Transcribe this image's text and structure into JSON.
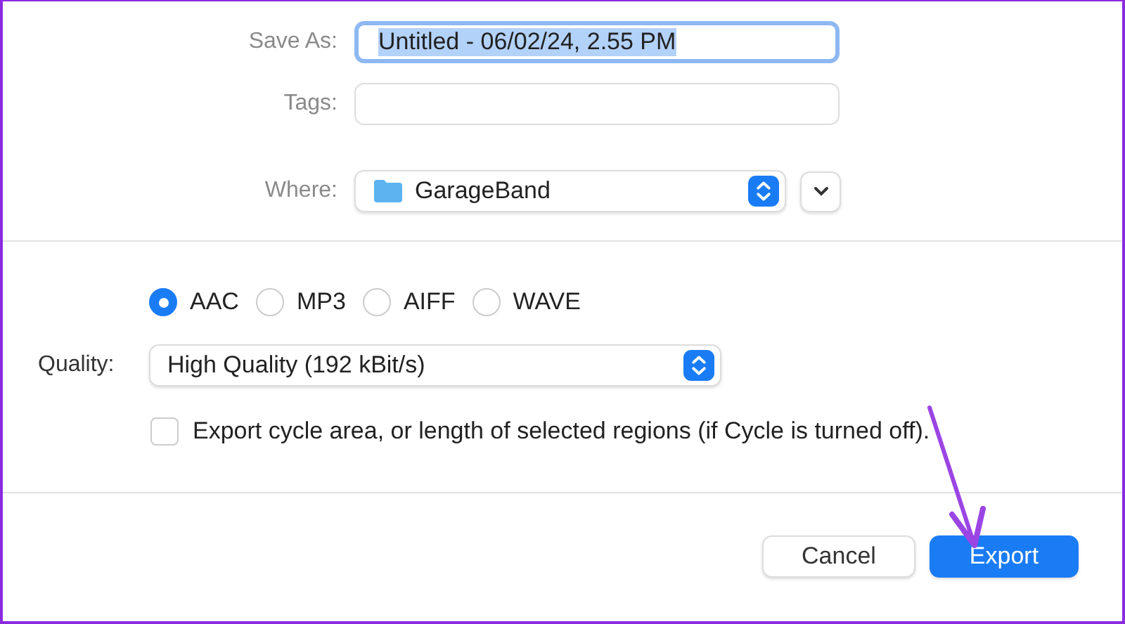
{
  "fields": [
    {
      "kind": "text",
      "label": "Save As:",
      "value": "Untitled - 06/02/24, 2.55 PM",
      "focused": true,
      "text_selected": true
    },
    {
      "kind": "text",
      "label": "Tags:",
      "focused": false
    },
    {
      "kind": "location",
      "label": "Where:",
      "value": "GarageBand",
      "expanded": false
    }
  ],
  "formats": [
    {
      "label": "AAC",
      "selected": true
    },
    {
      "label": "MP3",
      "selected": false
    },
    {
      "label": "AIFF",
      "selected": false
    },
    {
      "label": "WAVE",
      "selected": false
    }
  ],
  "quality": {
    "label": "Quality:",
    "value": "High Quality (192 kBit/s)"
  },
  "cycle_option": {
    "label": "Export cycle area, or length of selected regions (if Cycle is turned off).",
    "checked": false
  },
  "buttons": [
    {
      "label": "Cancel",
      "kind": "secondary"
    },
    {
      "label": "Export",
      "kind": "primary"
    }
  ]
}
